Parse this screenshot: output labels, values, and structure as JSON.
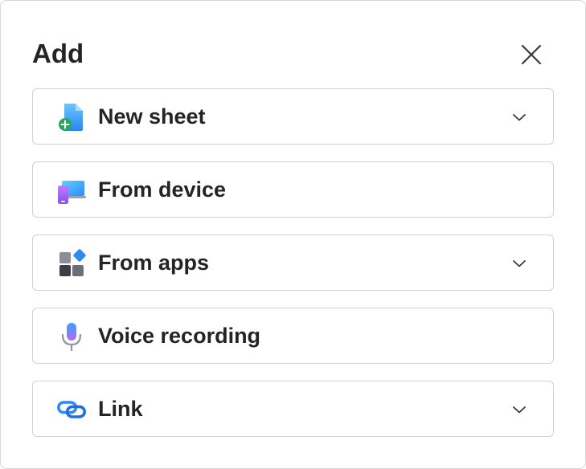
{
  "dialog": {
    "title": "Add",
    "close_icon": "close-icon"
  },
  "options": [
    {
      "label": "New sheet",
      "icon": "new-sheet-icon",
      "expandable": true
    },
    {
      "label": "From device",
      "icon": "device-icon",
      "expandable": false
    },
    {
      "label": "From apps",
      "icon": "apps-icon",
      "expandable": true
    },
    {
      "label": "Voice recording",
      "icon": "microphone-icon",
      "expandable": false
    },
    {
      "label": "Link",
      "icon": "link-icon",
      "expandable": true
    }
  ],
  "colors": {
    "text": "#242424",
    "border": "#d1d1d1",
    "accent_blue": "#2f8af5",
    "accent_green": "#2aa85a",
    "accent_purple": "#a86cf0"
  }
}
